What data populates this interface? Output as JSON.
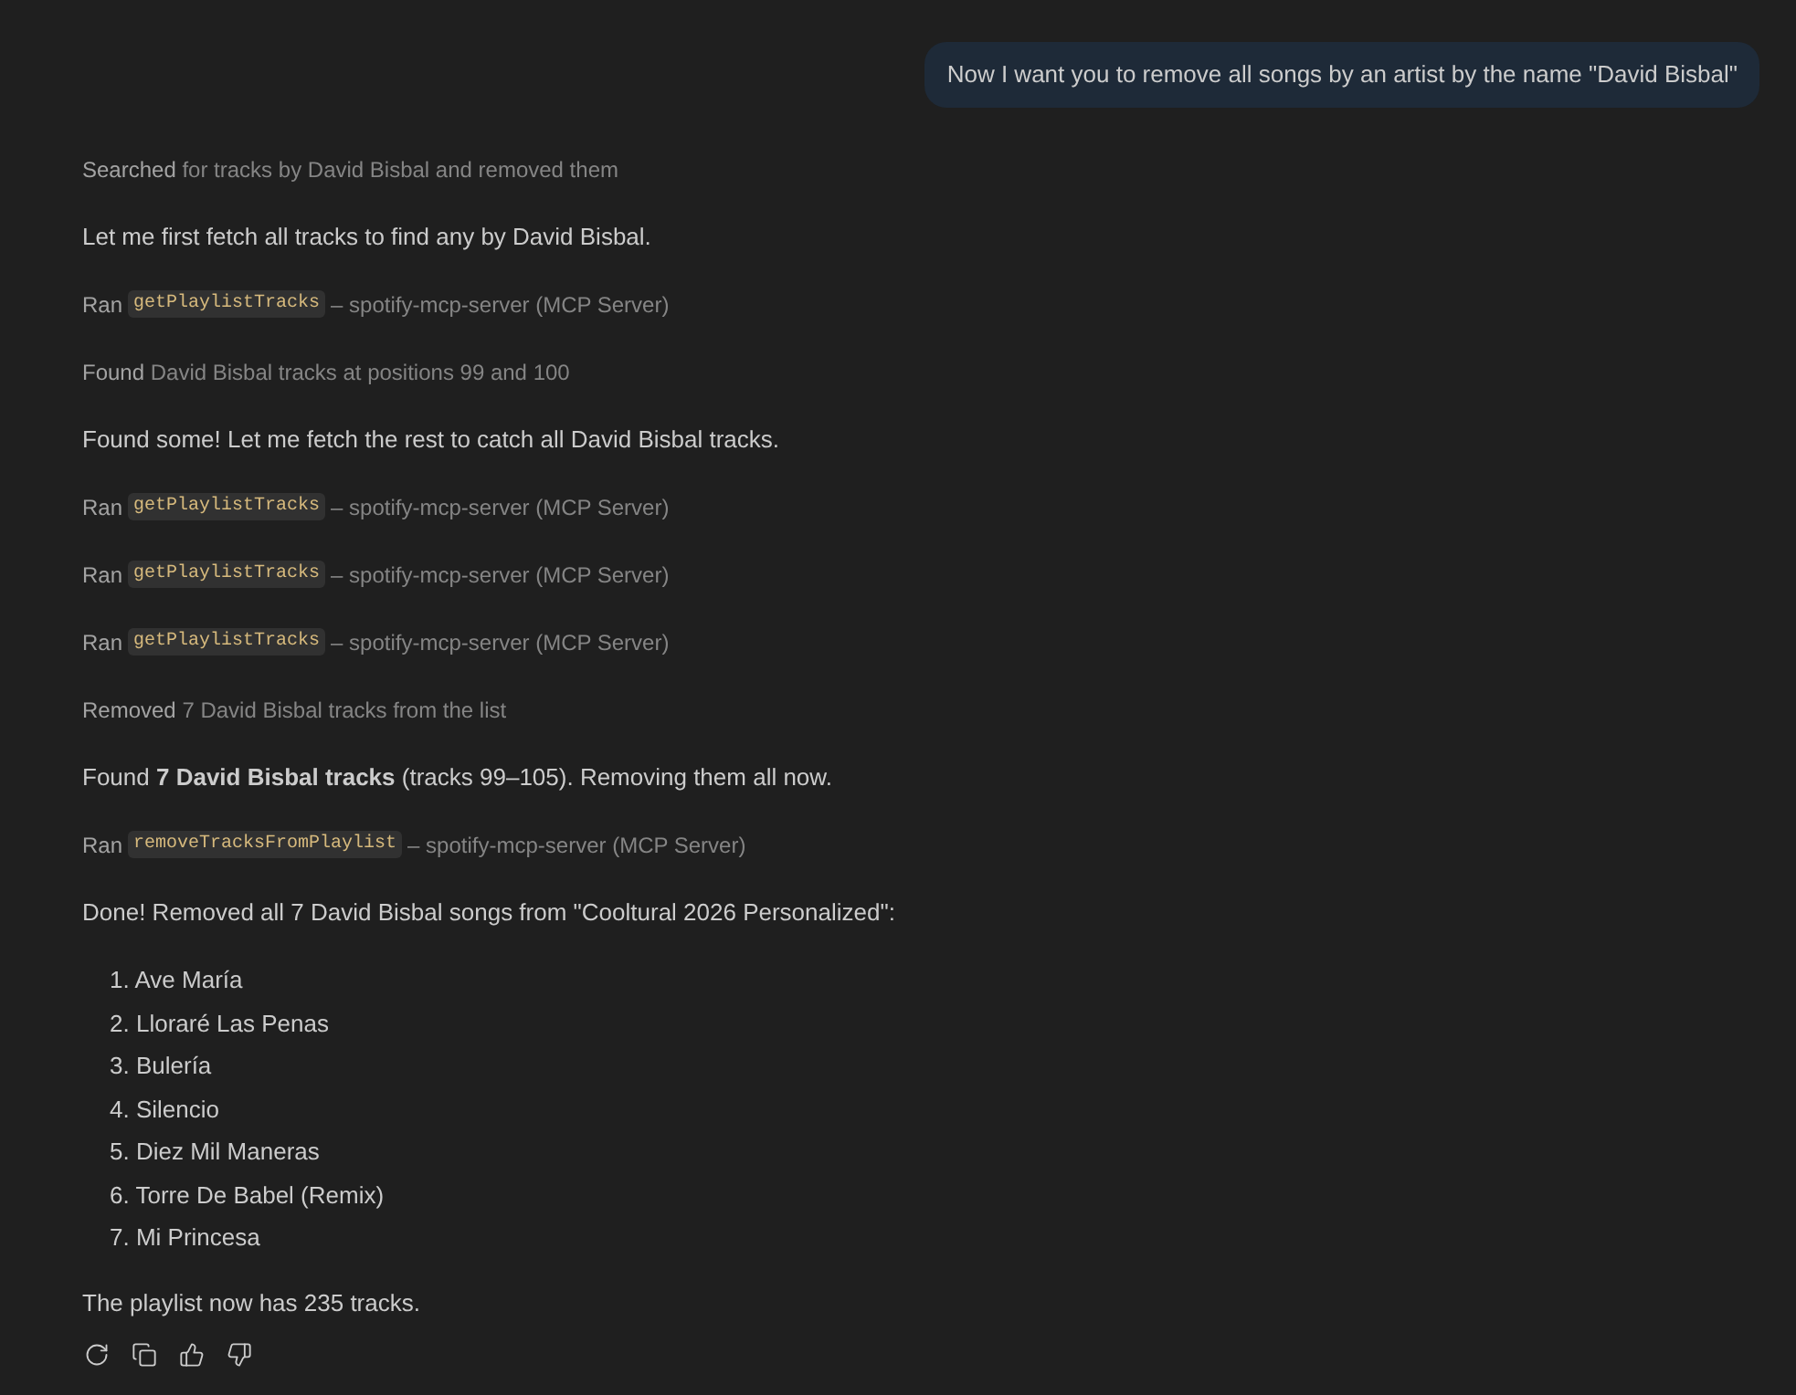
{
  "user_message": {
    "text": "Now I want you to remove all songs by an artist by the name \"David Bisbal\""
  },
  "steps": [
    {
      "kind": "progress",
      "verb": "Searched",
      "detail": "for tracks by David Bisbal and removed them"
    },
    {
      "kind": "text",
      "text": "Let me first fetch all tracks to find any by David Bisbal."
    },
    {
      "kind": "tool",
      "verb": "Ran",
      "tool": "getPlaylistTracks",
      "detail": "– spotify-mcp-server (MCP Server)"
    },
    {
      "kind": "progress",
      "verb": "Found",
      "detail": "David Bisbal tracks at positions 99 and 100"
    },
    {
      "kind": "text",
      "text": "Found some! Let me fetch the rest to catch all David Bisbal tracks."
    },
    {
      "kind": "tool",
      "verb": "Ran",
      "tool": "getPlaylistTracks",
      "detail": "– spotify-mcp-server (MCP Server)"
    },
    {
      "kind": "tool",
      "verb": "Ran",
      "tool": "getPlaylistTracks",
      "detail": "– spotify-mcp-server (MCP Server)"
    },
    {
      "kind": "tool",
      "verb": "Ran",
      "tool": "getPlaylistTracks",
      "detail": "– spotify-mcp-server (MCP Server)"
    },
    {
      "kind": "progress",
      "verb": "Removed",
      "detail": "7 David Bisbal tracks from the list"
    },
    {
      "kind": "text",
      "text": "Found **7 David Bisbal tracks** (tracks 99–105). Removing them all now."
    },
    {
      "kind": "tool",
      "verb": "Ran",
      "tool": "removeTracksFromPlaylist",
      "detail": "– spotify-mcp-server (MCP Server)"
    },
    {
      "kind": "text",
      "text": "Done! Removed all 7 David Bisbal songs from \"Cooltural 2026 Personalized\":"
    }
  ],
  "removed_songs": [
    {
      "number": "1.",
      "title": "Ave María"
    },
    {
      "number": "2.",
      "title": "Lloraré Las Penas"
    },
    {
      "number": "3.",
      "title": "Bulería"
    },
    {
      "number": "4.",
      "title": "Silencio"
    },
    {
      "number": "5.",
      "title": "Diez Mil Maneras"
    },
    {
      "number": "6.",
      "title": "Torre De Babel (Remix)"
    },
    {
      "number": "7.",
      "title": "Mi Princesa"
    }
  ],
  "summary": {
    "text": "The playlist now has 235 tracks."
  }
}
